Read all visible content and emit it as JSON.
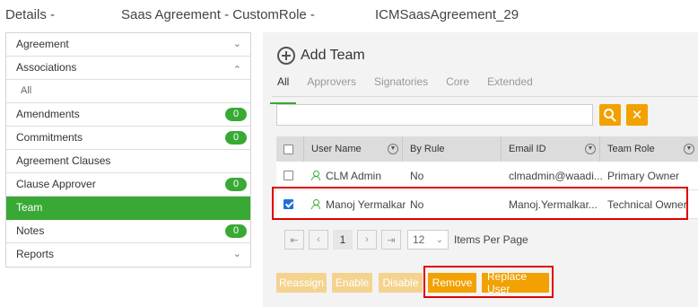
{
  "header": {
    "details": "Details -",
    "title": "Saas Agreement - CustomRole -",
    "id": "ICMSaasAgreement_29"
  },
  "sidebar": {
    "items": [
      {
        "label": "Agreement",
        "chevron": "down"
      },
      {
        "label": "Associations",
        "chevron": "up"
      },
      {
        "label": "All"
      },
      {
        "label": "Amendments",
        "badge": "0"
      },
      {
        "label": "Commitments",
        "badge": "0"
      },
      {
        "label": "Agreement Clauses"
      },
      {
        "label": "Clause Approver",
        "badge": "0"
      },
      {
        "label": "Team",
        "active": true
      },
      {
        "label": "Notes",
        "badge": "0"
      },
      {
        "label": "Reports",
        "chevron": "down"
      }
    ]
  },
  "main": {
    "add_team_label": "Add Team",
    "tabs": [
      "All",
      "Approvers",
      "Signatories",
      "Core",
      "Extended"
    ],
    "active_tab": "All",
    "search": {
      "value": "",
      "placeholder": ""
    },
    "table": {
      "headers": [
        "User Name",
        "By Rule",
        "Email ID",
        "Team Role"
      ],
      "rows": [
        {
          "checked": false,
          "user": "CLM Admin",
          "by_rule": "No",
          "email": "clmadmin@waadi...",
          "role": "Primary Owner"
        },
        {
          "checked": true,
          "user": "Manoj Yermalkar",
          "by_rule": "No",
          "email": "Manoj.Yermalkar...",
          "role": "Technical Owner"
        }
      ]
    },
    "pagination": {
      "current_page": "1",
      "page_size": "12",
      "items_per_page_label": "Items Per Page"
    },
    "actions": [
      {
        "label": "Reassign",
        "enabled": false
      },
      {
        "label": "Enable",
        "enabled": false
      },
      {
        "label": "Disable",
        "enabled": false
      },
      {
        "label": "Remove",
        "enabled": true
      },
      {
        "label": "Replace User",
        "enabled": true
      }
    ]
  },
  "colors": {
    "accent_green": "#39a935",
    "action_orange": "#f2a100",
    "disabled_orange": "#f4d38f",
    "highlight_red": "#e00000",
    "checkbox_blue": "#1e6fd9"
  }
}
